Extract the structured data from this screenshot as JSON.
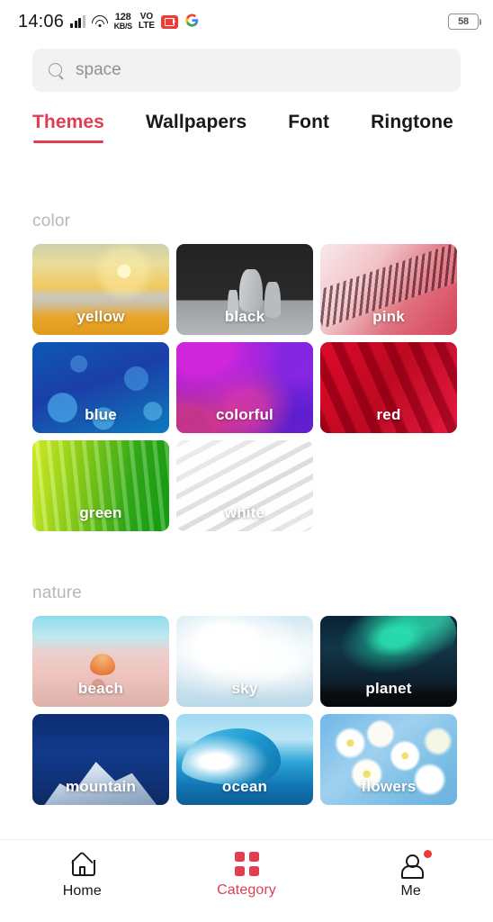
{
  "status_bar": {
    "time": "14:06",
    "network_speed_value": "128",
    "network_speed_unit": "KB/S",
    "volte_top": "VO",
    "volte_bottom": "LTE",
    "google_letter": "G",
    "battery_level": "58",
    "icons": [
      "signal-bars",
      "wifi",
      "network-speed",
      "volte",
      "screen-recorder",
      "google"
    ]
  },
  "search": {
    "placeholder": "space",
    "value": ""
  },
  "tabs": [
    {
      "label": "Themes",
      "active": true
    },
    {
      "label": "Wallpapers",
      "active": false
    },
    {
      "label": "Font",
      "active": false
    },
    {
      "label": "Ringtone",
      "active": false
    }
  ],
  "sections": [
    {
      "title": "color",
      "tiles": [
        {
          "label": "yellow",
          "art": "art-yellow"
        },
        {
          "label": "black",
          "art": "art-black"
        },
        {
          "label": "pink",
          "art": "art-pink"
        },
        {
          "label": "blue",
          "art": "art-blue"
        },
        {
          "label": "colorful",
          "art": "art-colorful"
        },
        {
          "label": "red",
          "art": "art-red"
        },
        {
          "label": "green",
          "art": "art-green"
        },
        {
          "label": "white",
          "art": "art-white"
        }
      ]
    },
    {
      "title": "nature",
      "tiles": [
        {
          "label": "beach",
          "art": "art-beach"
        },
        {
          "label": "sky",
          "art": "art-sky"
        },
        {
          "label": "planet",
          "art": "art-planet"
        },
        {
          "label": "mountain",
          "art": "art-mountain"
        },
        {
          "label": "ocean",
          "art": "art-ocean"
        },
        {
          "label": "flowers",
          "art": "art-flowers"
        }
      ]
    }
  ],
  "bottom_nav": [
    {
      "label": "Home",
      "icon": "home-icon",
      "active": false,
      "badge": false
    },
    {
      "label": "Category",
      "icon": "category-icon",
      "active": true,
      "badge": false
    },
    {
      "label": "Me",
      "icon": "person-icon",
      "active": false,
      "badge": true
    }
  ],
  "colors": {
    "accent": "#e03e52",
    "badge": "#f03a3a",
    "text": "#17181a",
    "muted": "#b5b7bb",
    "search_bg": "#f2f2f3"
  }
}
